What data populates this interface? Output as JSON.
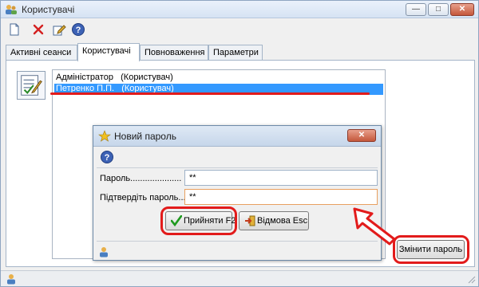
{
  "window": {
    "title": "Користувачі",
    "min_glyph": "—",
    "max_glyph": "□",
    "close_glyph": "✕"
  },
  "toolbar": {
    "icons": [
      "new-document-icon",
      "delete-icon",
      "edit-icon",
      "help-icon"
    ]
  },
  "tabs": [
    {
      "label": "Активні сеанси"
    },
    {
      "label": "Користувачі"
    },
    {
      "label": "Повноваження"
    },
    {
      "label": "Параметри"
    }
  ],
  "users": [
    {
      "label": "Адміністратор   (Користувач)"
    },
    {
      "label": "Петренко П.П.   (Користувач)"
    }
  ],
  "change_password_label": "Змінити пароль",
  "dialog": {
    "title": "Новий пароль",
    "close_glyph": "✕",
    "password_label": "Пароль.....................",
    "password_value": "**",
    "confirm_label": "Підтвердіть пароль....",
    "confirm_value": "**",
    "ok_label": "Прийняти F2",
    "cancel_label": "Відмова Esc"
  },
  "colors": {
    "highlight": "#e21b1b",
    "selection": "#3399ff"
  }
}
